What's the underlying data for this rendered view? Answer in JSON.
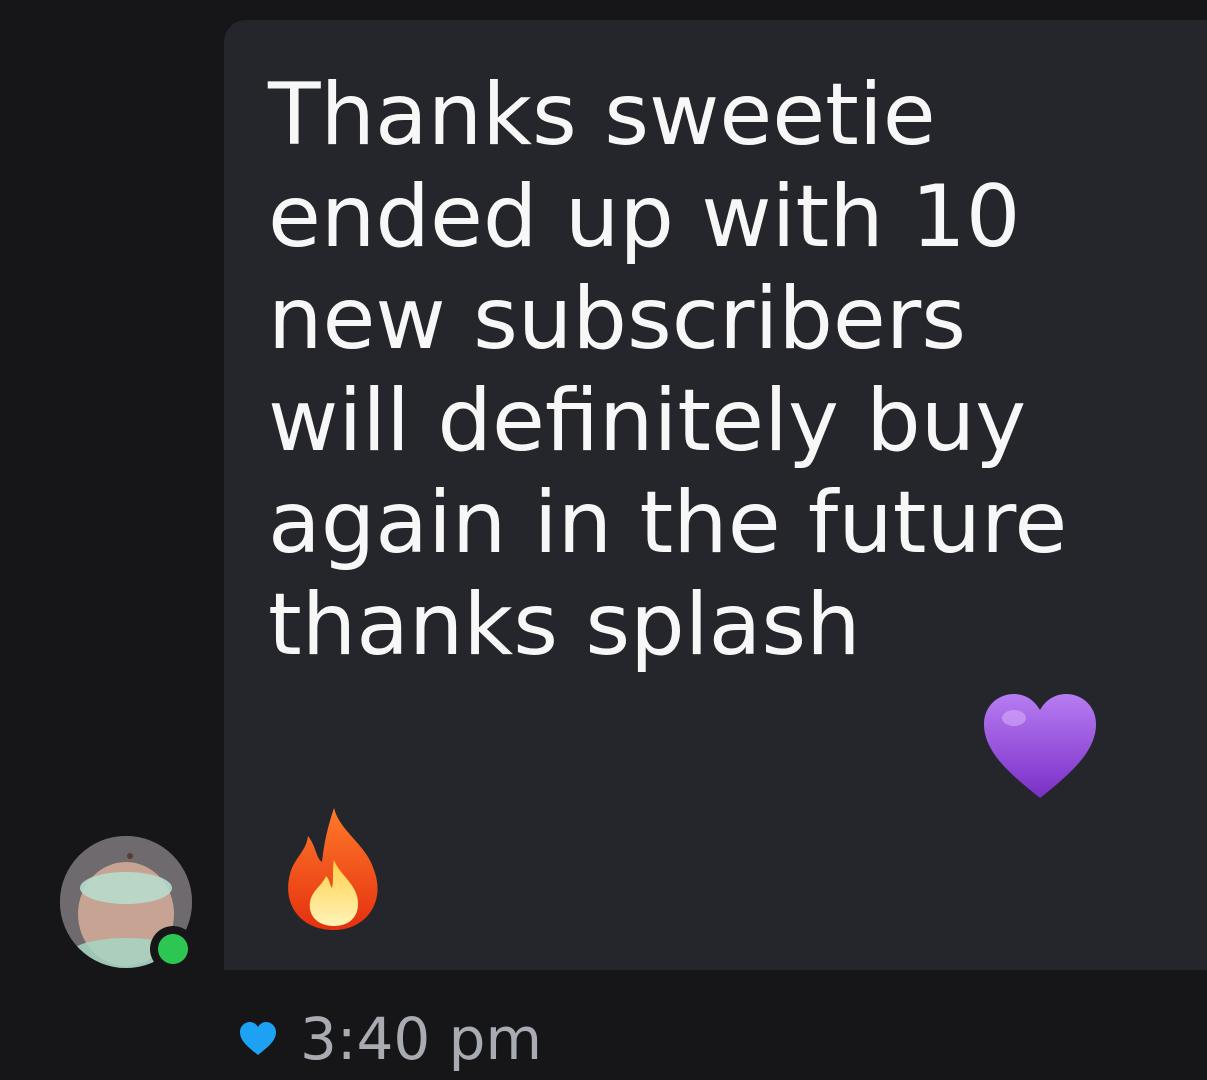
{
  "message": {
    "text": "Thanks sweetie\nended up with 10\nnew subscribers\nwill definitely buy\nagain in the future\nthanks splash",
    "emojis": [
      "purple-heart-emoji",
      "fire-emoji"
    ]
  },
  "sender": {
    "online": true
  },
  "meta": {
    "timestamp": "3:40 pm",
    "liked": true
  },
  "colors": {
    "background": "#161619",
    "bubble": "#25262b",
    "text": "#f7f7f7",
    "online": "#2dc653",
    "like": "#1da1f2",
    "heart": "#9b4de0",
    "fire": "#f24a1b"
  }
}
